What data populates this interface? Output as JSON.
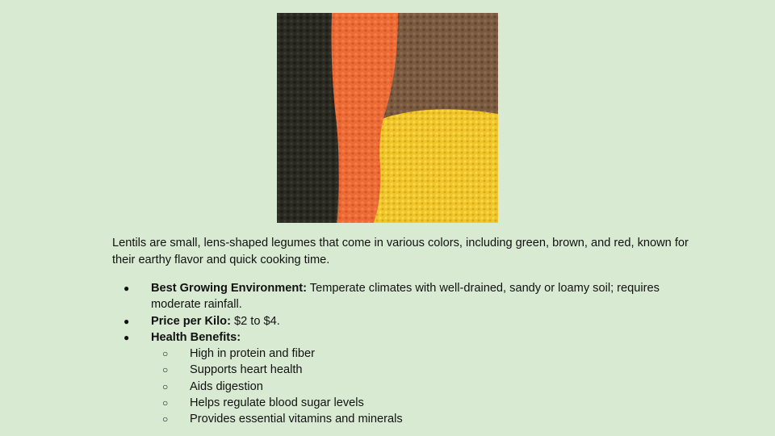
{
  "intro": "Lentils are small, lens-shaped legumes that come in various colors, including green, brown, and red, known for their earthy flavor and quick cooking time.",
  "bullets": {
    "environment": {
      "label": "Best Growing Environment:",
      "text": " Temperate climates with well-drained, sandy or loamy soil; requires moderate rainfall."
    },
    "price": {
      "label": "Price per Kilo:",
      "text": " $2 to $4."
    },
    "health": {
      "label": "Health Benefits:",
      "items": [
        "High in protein and fiber",
        "Supports heart health",
        "Aids digestion",
        "Helps regulate blood sugar levels",
        "Provides essential vitamins and minerals"
      ]
    }
  },
  "markers": {
    "bullet": "●",
    "sub_bullet": "○"
  },
  "colors": {
    "background": "#d9ead3",
    "black_lentils": "#2a2a22",
    "red_lentils": "#ec6a35",
    "brown_lentils": "#7a5a40",
    "yellow_lentils": "#f0c52a"
  }
}
